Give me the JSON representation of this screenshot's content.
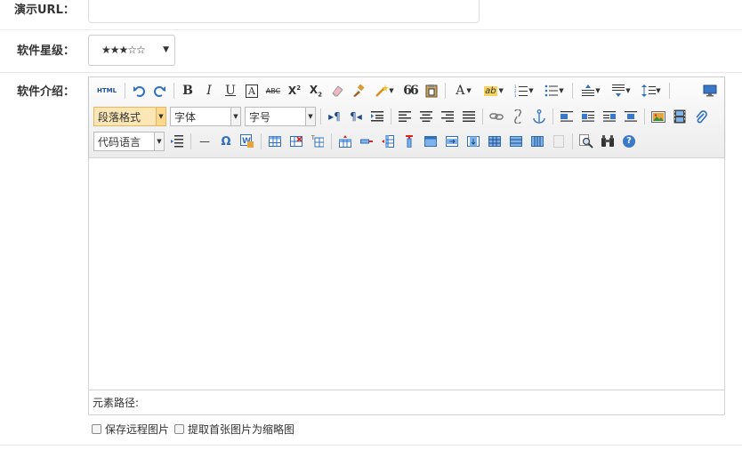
{
  "fields": {
    "demo_url": {
      "label": "演示URL：",
      "value": ""
    },
    "rating": {
      "label": "软件星级：",
      "value": "★★★☆☆",
      "arrow": "▼"
    },
    "intro": {
      "label": "软件介绍："
    }
  },
  "editor": {
    "toolbar": {
      "html_label": "HTML",
      "paragraph_format": "段落格式",
      "font_family": "字体",
      "font_size": "字号",
      "code_language": "代码语言",
      "bold": "B",
      "italic": "I",
      "underline": "U",
      "strikethrough": "ABC",
      "superscript_base": "X",
      "superscript_mark": "2",
      "subscript_base": "X",
      "subscript_mark": "2",
      "quote": "66",
      "font_color": "A",
      "highlight": "ab",
      "horizontal_rule": "—",
      "special_char": "Ω",
      "help": "?"
    },
    "path_label": "元素路径:",
    "content": ""
  },
  "options": {
    "save_remote_images": "保存远程图片",
    "first_image_as_thumbnail": "提取首张图片为缩略图"
  },
  "colors": {
    "accent_blue": "#2f6fbf",
    "active_combo": "#fbe7b5",
    "border": "#d4d4d4"
  }
}
